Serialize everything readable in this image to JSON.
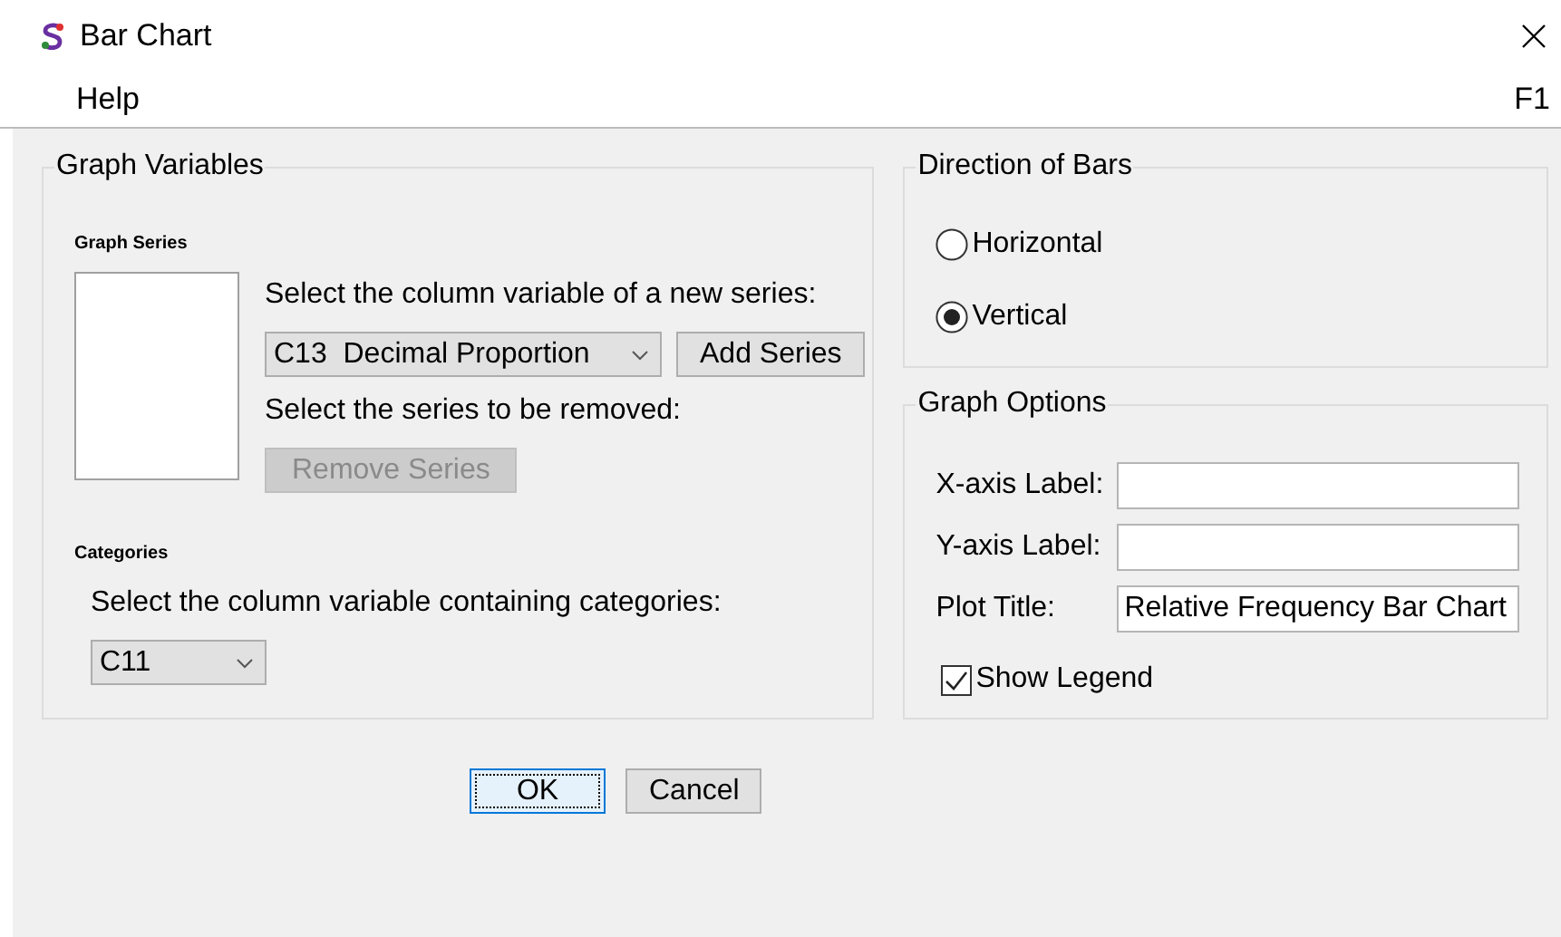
{
  "window": {
    "title": "Bar Chart"
  },
  "menu": {
    "items": [
      {
        "label": "Help"
      }
    ],
    "shortcut": "F1"
  },
  "graph_variables": {
    "title": "Graph Variables",
    "graph_series": {
      "title": "Graph Series",
      "new_series_prompt": "Select the column variable of a new series:",
      "new_series_value": "C13  Decimal Proportion",
      "add_button": {
        "label": "Add Series",
        "disabled": false
      },
      "remove_prompt": "Select the series to be removed:",
      "remove_button": {
        "label": "Remove Series",
        "disabled": true
      }
    },
    "categories": {
      "title": "Categories",
      "prompt": "Select the column variable containing categories:",
      "value": "C11"
    }
  },
  "direction": {
    "title": "Direction of Bars",
    "options": [
      {
        "label": "Horizontal",
        "selected": false
      },
      {
        "label": "Vertical",
        "selected": true
      }
    ]
  },
  "graph_options": {
    "title": "Graph Options",
    "fields": [
      {
        "label": "X-axis Label:"
      },
      {
        "label": "Y-axis Label:"
      },
      {
        "label": "Plot Title:",
        "value": "Relative Frequency Bar Chart"
      }
    ],
    "show_legend": {
      "label": "Show Legend",
      "checked": true
    }
  },
  "buttons": [
    {
      "label": "OK",
      "default": true
    },
    {
      "label": "Cancel",
      "default": false
    }
  ]
}
